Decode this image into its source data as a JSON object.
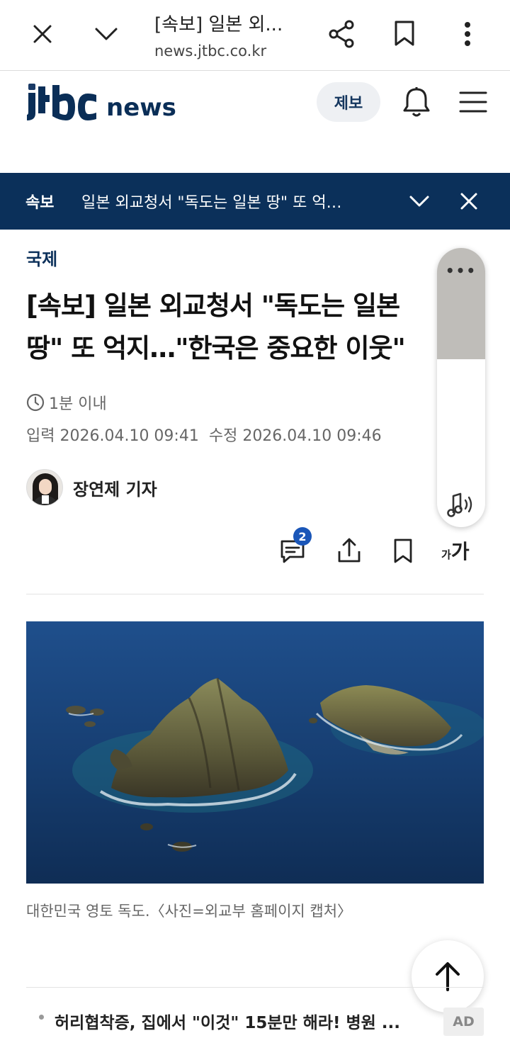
{
  "browser": {
    "tab_title": "[속보] 일본 외...",
    "url": "news.jtbc.co.kr"
  },
  "site": {
    "logo_jtbc": "JTbC",
    "logo_news": "news",
    "tip_label": "제보"
  },
  "breaking": {
    "tag": "속보",
    "text": "일본 외교청서 \"독도는 일본 땅\" 또 억…"
  },
  "article": {
    "category": "국제",
    "headline_line1": "[속보] 일본 외교청서 \"독도는 일본",
    "headline_line2": "땅\" 또 억지…\"한국은 중요한 이웃\"",
    "read_time": "1분 이내",
    "input_date": "입력 2026.04.10 09:41",
    "modified_date": "수정 2026.04.10 09:46",
    "author": "장연제 기자",
    "comment_count": "2",
    "font_small": "가",
    "font_big": "가",
    "caption": "대한민국 영토 독도.〈사진=외교부 홈페이지 캡처〉"
  },
  "tts": {
    "menu": "•••"
  },
  "ad": {
    "text": "허리협착증, 집에서 \"이것\" 15분만 해라! 병원 ...",
    "badge": "AD"
  },
  "colors": {
    "brand_navy": "#0b305a",
    "badge_blue": "#1a56b8"
  }
}
